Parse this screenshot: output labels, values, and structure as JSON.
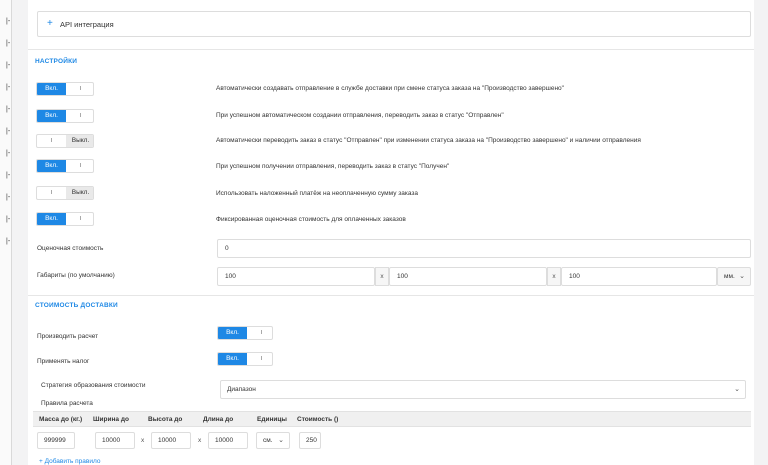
{
  "api_section": {
    "icon": "plus-icon",
    "label": "API интеграция"
  },
  "settings": {
    "title": "НАСТРОЙКИ",
    "toggles": [
      {
        "state": "on",
        "on_label": "Вкл.",
        "off_label": "Выкл.",
        "description": "Автоматически создавать отправление в службе доставки при смене статуса заказа на \"Производство завершено\""
      },
      {
        "state": "on",
        "on_label": "Вкл.",
        "off_label": "Выкл.",
        "description": "При успешном автоматическом создании отправления, переводить заказ в статус \"Отправлен\""
      },
      {
        "state": "off",
        "on_label": "Вкл.",
        "off_label": "Выкл.",
        "description": "Автоматически переводить заказ в статус \"Отправлен\" при изменении статуса заказа на \"Производство завершено\" и наличии отправления"
      },
      {
        "state": "on",
        "on_label": "Вкл.",
        "off_label": "Выкл.",
        "description": "При успешном получении отправления, переводить заказ в статус \"Получен\""
      },
      {
        "state": "off",
        "on_label": "Вкл.",
        "off_label": "Выкл.",
        "description": "Использовать наложенный платёж на неоплаченную сумму заказа"
      },
      {
        "state": "on",
        "on_label": "Вкл.",
        "off_label": "Выкл.",
        "description": "Фиксированная оценочная стоимость для оплаченных заказов"
      }
    ],
    "estimated_cost": {
      "label": "Оценочная стоимость",
      "value": "0"
    },
    "dimensions": {
      "label": "Габариты (по умолчанию)",
      "width": "100",
      "height": "100",
      "length": "100",
      "separator": "x",
      "unit": "мм."
    }
  },
  "delivery": {
    "title": "СТОИМОСТЬ ДОСТАВКИ",
    "calculate": {
      "label": "Производить расчет",
      "state": "on",
      "on_label": "Вкл.",
      "off_label": "Выкл."
    },
    "tax": {
      "label": "Применять налог",
      "state": "on",
      "on_label": "Вкл.",
      "off_label": "Выкл."
    },
    "strategy": {
      "label": "Стратегия образования стоимости",
      "value": "Диапазон"
    },
    "rules_label": "Правила расчета",
    "table": {
      "headers": [
        "Масса до (кг.)",
        "Ширина до",
        "Высота до",
        "Длина до",
        "Единицы",
        "Стоимость ()"
      ],
      "rows": [
        {
          "mass": "999999",
          "width": "10000",
          "height": "10000",
          "length": "10000",
          "unit": "см.",
          "cost": "250"
        }
      ],
      "separator": "x"
    },
    "add_rule": "Добавить правило"
  }
}
